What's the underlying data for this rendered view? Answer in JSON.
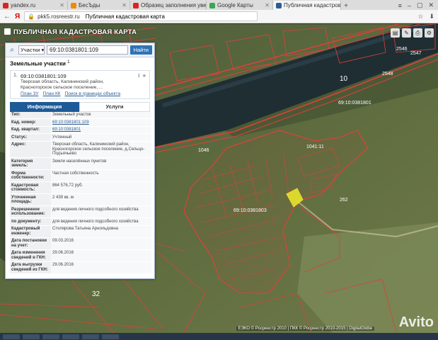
{
  "browser": {
    "tabs": [
      {
        "label": "yandex.ru",
        "color": "#d22"
      },
      {
        "label": "БесЪды",
        "color": "#f08a00"
      },
      {
        "label": "Образец заполнения увед",
        "color": "#d22"
      },
      {
        "label": "Google Карты",
        "color": "#34a853"
      },
      {
        "label": "Публичная кадастровая",
        "color": "#2a5d95",
        "active": true
      }
    ],
    "url_host": "pkk5.rosreestr.ru",
    "url_title": "Публичная кадастровая карта"
  },
  "site": {
    "title": "ПУБЛИЧНАЯ КАДАСТРОВАЯ КАРТА"
  },
  "search": {
    "type_label": "Участки",
    "query": "69:10:0381801:109",
    "button_label": "Найти"
  },
  "results": {
    "heading": "Земельные участки",
    "count": "1",
    "item": {
      "number": "1.",
      "cadastral_id": "69:10:0381801:109",
      "address_lines": [
        "Тверская область, Калининский район,",
        "Красногорское сельское поселение, ..."
      ],
      "links": [
        "План ЗУ",
        "План КК",
        "Поиск в границах объекта"
      ]
    }
  },
  "info_tabs": {
    "info": "Информация",
    "services": "Услуги"
  },
  "attributes": [
    {
      "k": "Тип:",
      "v": "Земельный участок"
    },
    {
      "k": "Кад. номер:",
      "v": "69:10:0381801:109",
      "link": true
    },
    {
      "k": "Кад. квартал:",
      "v": "69:10:0381801",
      "link": true
    },
    {
      "k": "Статус:",
      "v": "Учтенный"
    },
    {
      "k": "Адрес:",
      "v": "Тверская область, Калининский район, Красногорское сельское поселение, д.Сельцо-Подъячьево"
    },
    {
      "k": "Категория земель:",
      "v": "Земли населённых пунктов"
    },
    {
      "k": "Форма собственности:",
      "v": "Частная собственность"
    },
    {
      "k": "Кадастровая стоимость:",
      "v": "864 576,72 руб."
    },
    {
      "k": "Уточненная площадь:",
      "v": "2 439 кв. м"
    },
    {
      "k": "Разрешенное использование:",
      "v": "для ведения личного подсобного хозяйства"
    },
    {
      "k": "по документу:",
      "v": "для ведения личного подсобного хозяйства"
    },
    {
      "k": "Кадастровый инженер:",
      "v": "Столярова Татьяна Арнольдовна"
    },
    {
      "k": "Дата постановки на учет:",
      "v": "09.03.2016"
    },
    {
      "k": "Дата изменения сведений в ГКН:",
      "v": "29.06.2016"
    },
    {
      "k": "Дата выгрузки сведений из ГКН:",
      "v": "29.06.2016"
    }
  ],
  "map_labels": [
    "69:10:0381801",
    "2546",
    "2547",
    "2548",
    "1041:11",
    "10",
    "32",
    "69:10:0381803",
    "1046",
    "262"
  ],
  "attribution": "ЕЭКО © Росреестр 2010 | ПКК © Росреестр 2010-2015 | DigitalGlobe",
  "watermark": "Avito",
  "colors": {
    "parcel_line": "#e0403a",
    "highlight": "#e8e32a",
    "panel_accent": "#1d5a98"
  }
}
